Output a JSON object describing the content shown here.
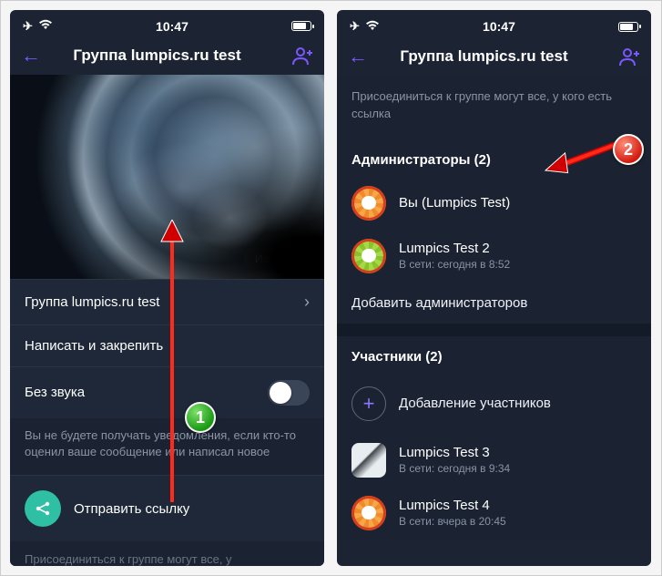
{
  "status": {
    "time": "10:47"
  },
  "header": {
    "title": "Группа lumpics.ru test"
  },
  "left": {
    "edit_label": "Изменить",
    "group_name": "Группа lumpics.ru test",
    "write_pin": "Написать и закрепить",
    "mute": "Без звука",
    "mute_hint": "Вы не будете получать уведомления, если кто-то оценил ваше сообщение или написал новое",
    "share_link": "Отправить ссылку",
    "cutoff": "Присоединиться к группе могут все, у"
  },
  "right": {
    "join_hint": "Присоединиться к группе могут все, у кого есть ссылка",
    "admins_header": "Администраторы (2)",
    "admin1": "Вы (Lumpics Test)",
    "admin2_name": "Lumpics Test 2",
    "admin2_sub": "В сети: сегодня в 8:52",
    "add_admins": "Добавить администраторов",
    "members_header": "Участники (2)",
    "add_members": "Добавление участников",
    "member1_name": "Lumpics Test 3",
    "member1_sub": "В сети: сегодня в 9:34",
    "member2_name": "Lumpics Test 4",
    "member2_sub": "В сети: вчера в 20:45"
  },
  "badges": {
    "one": "1",
    "two": "2"
  }
}
